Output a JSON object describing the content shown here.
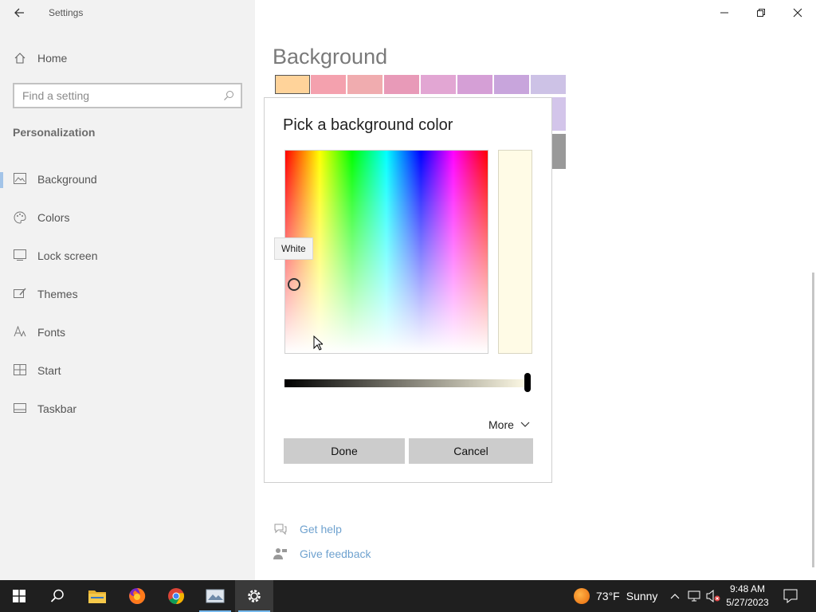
{
  "window": {
    "title": "Settings"
  },
  "sidebar": {
    "home_label": "Home",
    "search_placeholder": "Find a setting",
    "section_title": "Personalization",
    "items": [
      {
        "label": "Background",
        "icon": "picture-icon",
        "active": true
      },
      {
        "label": "Colors",
        "icon": "palette-icon",
        "active": false
      },
      {
        "label": "Lock screen",
        "icon": "lock-screen-icon",
        "active": false
      },
      {
        "label": "Themes",
        "icon": "brush-icon",
        "active": false
      },
      {
        "label": "Fonts",
        "icon": "font-icon",
        "active": false
      },
      {
        "label": "Start",
        "icon": "start-tiles-icon",
        "active": false
      },
      {
        "label": "Taskbar",
        "icon": "taskbar-icon",
        "active": false
      }
    ]
  },
  "main": {
    "title": "Background",
    "swatch_colors_row1": [
      "#ffd39a",
      "#f4a1ae",
      "#f0acaf",
      "#e89ab8",
      "#e2a6d3",
      "#d59fd6",
      "#c8a5dc",
      "#cdc2e6"
    ],
    "swatch_colors_right": [
      "#d3c5ea",
      "#999999"
    ],
    "help_links": [
      {
        "label": "Get help",
        "icon": "help-chat-icon"
      },
      {
        "label": "Give feedback",
        "icon": "feedback-person-icon"
      }
    ]
  },
  "dialog": {
    "title": "Pick a background color",
    "tooltip": "White",
    "preview_color": "#fffbe6",
    "more_label": "More",
    "done_label": "Done",
    "cancel_label": "Cancel"
  },
  "taskbar": {
    "apps": [
      "windows-start-icon",
      "search-icon",
      "file-explorer-icon",
      "firefox-icon",
      "chrome-icon",
      "photos-app-icon",
      "settings-gear-icon"
    ],
    "weather": {
      "temp": "73°F",
      "condition": "Sunny"
    },
    "clock": {
      "time": "9:48 AM",
      "date": "5/27/2023"
    }
  },
  "colors": {
    "accent": "#0078d7",
    "link": "#6fa2cf",
    "taskbar_bg": "#1f1f1f"
  }
}
